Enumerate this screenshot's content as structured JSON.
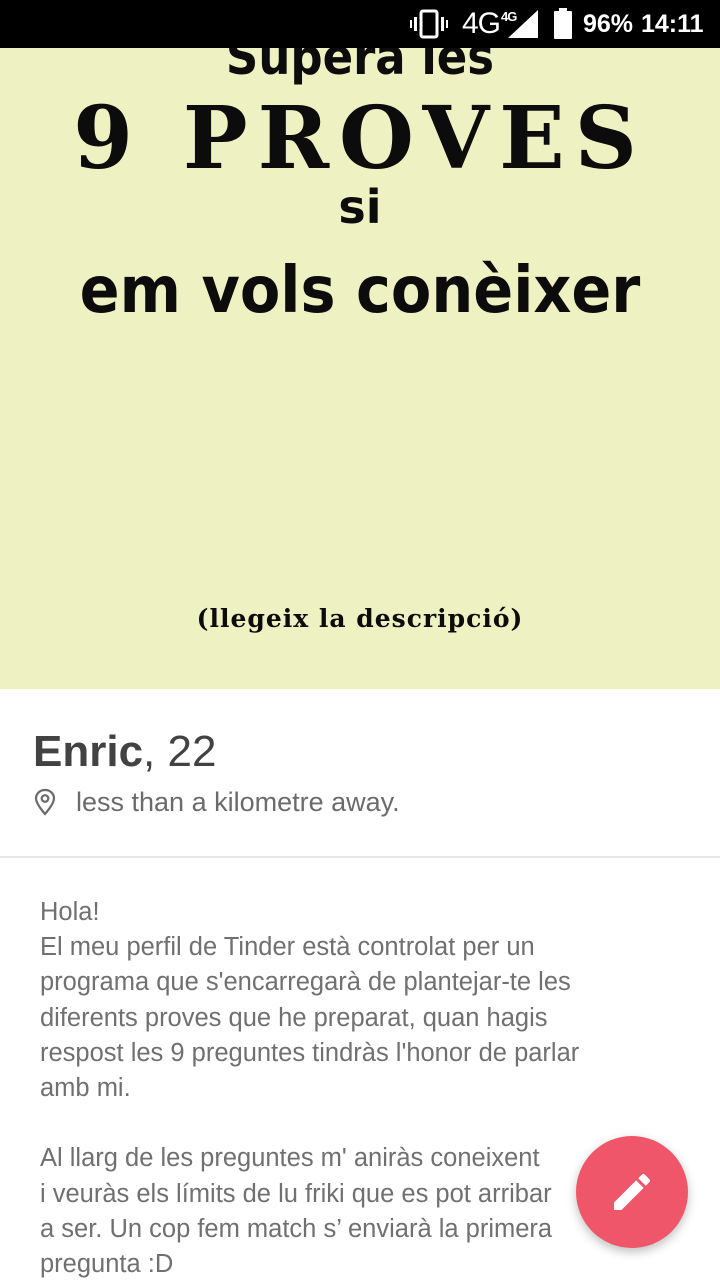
{
  "status_bar": {
    "network": "4G",
    "network_badge": "4G",
    "battery_percent": "96%",
    "time": "14:11",
    "icons": [
      "vibrate-icon",
      "signal-icon",
      "battery-icon"
    ]
  },
  "photo": {
    "line1": "Supera les",
    "line2": "9 PROVES",
    "line3": "si",
    "line4": "em vols conèixer",
    "line5": "(llegeix la descripció)"
  },
  "profile": {
    "name": "Enric",
    "separator": ", ",
    "age": "22",
    "location_icon": "location-pin-icon",
    "distance": "less than a kilometre away."
  },
  "bio": {
    "lines": [
      "Hola!",
      "El meu perfil de Tinder està controlat per un",
      "programa que s'encarregarà de plantejar-te les",
      "diferents proves que he preparat, quan hagis",
      "respost les 9 preguntes tindràs l'honor de parlar",
      "amb mi.",
      "",
      "Al llarg de les preguntes m' aniràs coneixent",
      "i veuràs els límits de lu friki que es pot arribar",
      "a ser. Un cop fem match s’ enviarà la primera",
      "pregunta :D"
    ]
  },
  "fab": {
    "icon": "pencil-icon",
    "color": "#f0566a"
  },
  "colors": {
    "photo_background": "#eef2c2",
    "accent": "#f0566a",
    "status_bar": "#000000"
  }
}
